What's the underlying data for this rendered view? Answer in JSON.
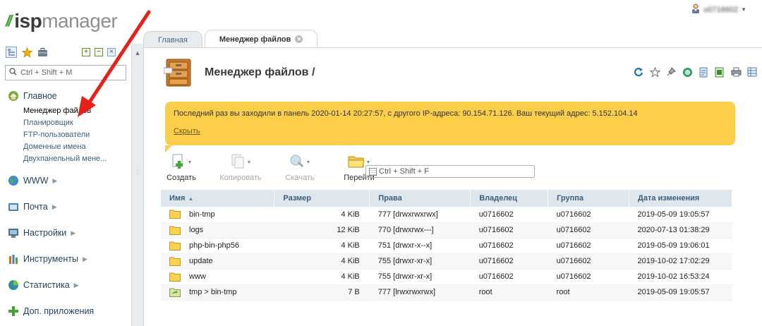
{
  "app": {
    "logo_isp": "isp",
    "logo_manager": "manager",
    "user_name": "u0716602"
  },
  "sidebar": {
    "search_placeholder": "Ctrl + Shift + M",
    "sections": [
      {
        "label": "Главное",
        "icon": "home-icon",
        "expanded": true,
        "items": [
          "Менеджер файлов",
          "Планировщик",
          "FTP-пользователи",
          "Доменные имена",
          "Двухпанельный мене..."
        ]
      },
      {
        "label": "WWW",
        "icon": "globe-icon",
        "expanded": false
      },
      {
        "label": "Почта",
        "icon": "mail-icon",
        "expanded": false
      },
      {
        "label": "Настройки",
        "icon": "settings-icon",
        "expanded": false
      },
      {
        "label": "Инструменты",
        "icon": "tools-icon",
        "expanded": false
      },
      {
        "label": "Статистика",
        "icon": "stats-icon",
        "expanded": false
      },
      {
        "label": "Доп. приложения",
        "icon": "plus-icon",
        "expanded": false
      }
    ]
  },
  "tabs": [
    {
      "label": "Главная",
      "active": false
    },
    {
      "label": "Менеджер файлов",
      "active": true
    }
  ],
  "page": {
    "title": "Менеджер файлов /"
  },
  "notice": {
    "text": "Последний раз вы заходили в панель 2020-01-14 20:27:57, с другого IP-адреса: 90.154.71.126. Ваш текущий адрес: 5.152.104.14",
    "hide_label": "Скрыть"
  },
  "actions": {
    "create": "Создать",
    "copy": "Копировать",
    "download": "Скачать",
    "goto": "Перейти"
  },
  "filter": {
    "placeholder": "Ctrl + Shift + F"
  },
  "table": {
    "columns": [
      "Имя",
      "Размер",
      "Права",
      "Владелец",
      "Группа",
      "Дата изменения"
    ],
    "rows": [
      {
        "name": "bin-tmp",
        "size": "4 KiB",
        "perms": "777 [drwxrwxrwx]",
        "owner": "u0716602",
        "group": "u0716602",
        "date": "2019-05-09 19:05:57",
        "type": "folder"
      },
      {
        "name": "logs",
        "size": "12 KiB",
        "perms": "770 [drwxrwx---]",
        "owner": "u0716602",
        "group": "u0716602",
        "date": "2020-07-13 01:38:29",
        "type": "folder"
      },
      {
        "name": "php-bin-php56",
        "size": "4 KiB",
        "perms": "751 [drwxr-x--x]",
        "owner": "u0716602",
        "group": "u0716602",
        "date": "2019-05-09 19:06:01",
        "type": "folder"
      },
      {
        "name": "update",
        "size": "4 KiB",
        "perms": "755 [drwxr-xr-x]",
        "owner": "u0716602",
        "group": "u0716602",
        "date": "2019-10-02 17:02:29",
        "type": "folder"
      },
      {
        "name": "www",
        "size": "4 KiB",
        "perms": "755 [drwxr-xr-x]",
        "owner": "u0716602",
        "group": "u0716602",
        "date": "2019-10-02 16:53:24",
        "type": "folder"
      },
      {
        "name": "tmp > bin-tmp",
        "size": "7 B",
        "perms": "777 [lrwxrwxrwx]",
        "owner": "root",
        "group": "root",
        "date": "2019-05-09 19:05:57",
        "type": "symlink"
      }
    ]
  },
  "colors": {
    "notice_bg": "#fcce4a",
    "brand_green": "#3fa535",
    "link": "#3e5d7a",
    "arrow": "#e8201a"
  }
}
